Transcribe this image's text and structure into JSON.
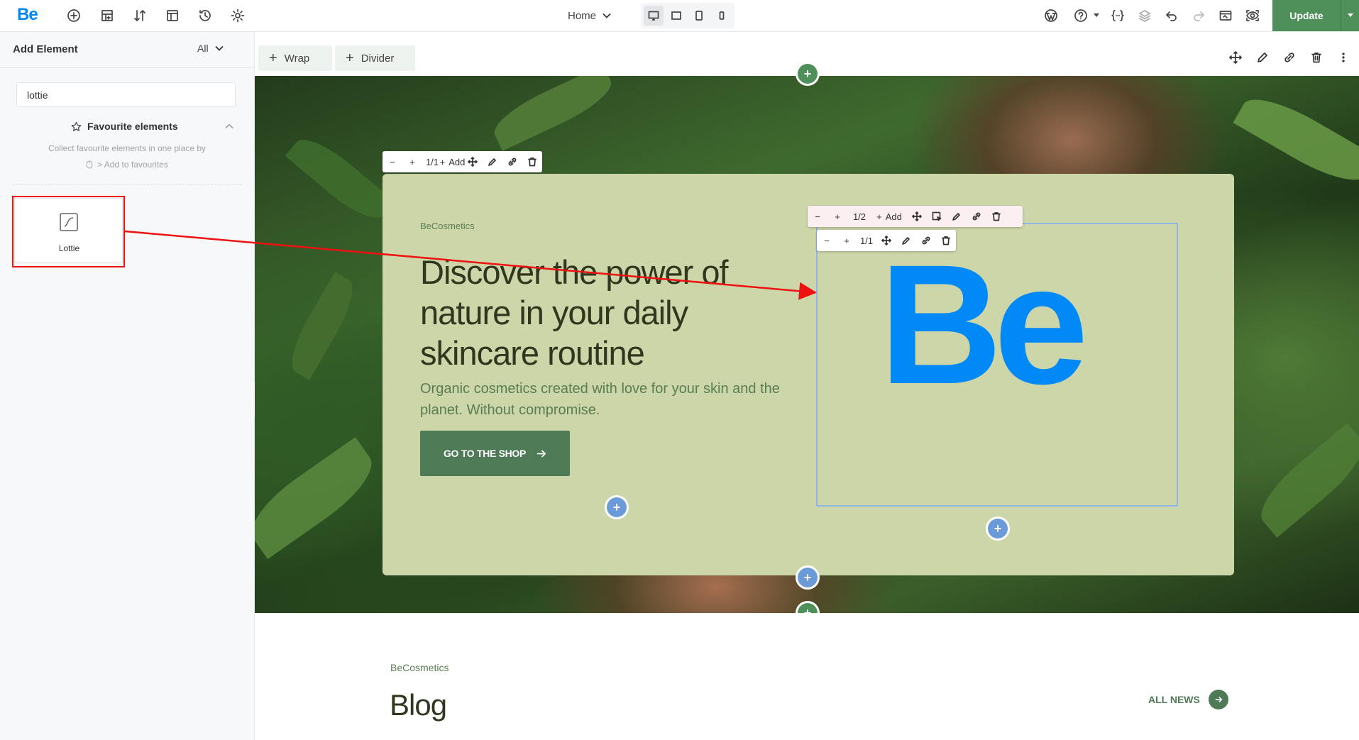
{
  "app": {
    "logo": "Be"
  },
  "topbar": {
    "page_select": "Home",
    "update_label": "Update",
    "left_icons": [
      "add-icon",
      "layout-icon",
      "sort-icon",
      "template-icon",
      "history-icon",
      "gear-icon"
    ],
    "right_icons": [
      "wordpress-icon",
      "help-icon",
      "css-icon",
      "layers-icon",
      "undo-icon",
      "redo-icon",
      "preview-icon",
      "eye-icon"
    ],
    "devices": [
      "desktop",
      "laptop",
      "tablet",
      "mobile"
    ],
    "active_device": "desktop"
  },
  "sidebar": {
    "title": "Add Element",
    "filter": "All",
    "search_value": "lottie",
    "favourites_title": "Favourite elements",
    "favourites_desc": "Collect favourite elements in one place by",
    "favourites_hint": "> Add to favourites",
    "elements": [
      {
        "label": "Lottie",
        "icon": "lottie-icon"
      }
    ]
  },
  "canvas": {
    "toolbar_buttons": [
      {
        "label": "Wrap"
      },
      {
        "label": "Divider"
      }
    ],
    "section_toolbar": {
      "size": "1/1",
      "add_label": "Add"
    },
    "column_toolbar": {
      "size": "1/2",
      "add_label": "Add"
    },
    "wrap_toolbar": {
      "size": "1/1"
    },
    "hero": {
      "brand": "BeCosmetics",
      "title": "Discover the power of nature in your daily skincare routine",
      "subtitle": "Organic cosmetics created with love for your skin and the planet. Without compromise.",
      "button_label": "GO TO THE SHOP",
      "logo_text": "Be"
    },
    "blog": {
      "brand": "BeCosmetics",
      "title": "Blog",
      "all_news_label": "ALL NEWS"
    }
  },
  "colors": {
    "brand_blue": "#0089f7",
    "accent_green": "#4e8f5a",
    "card_bg": "#ccd6a9",
    "highlight_red": "#ee1111"
  }
}
